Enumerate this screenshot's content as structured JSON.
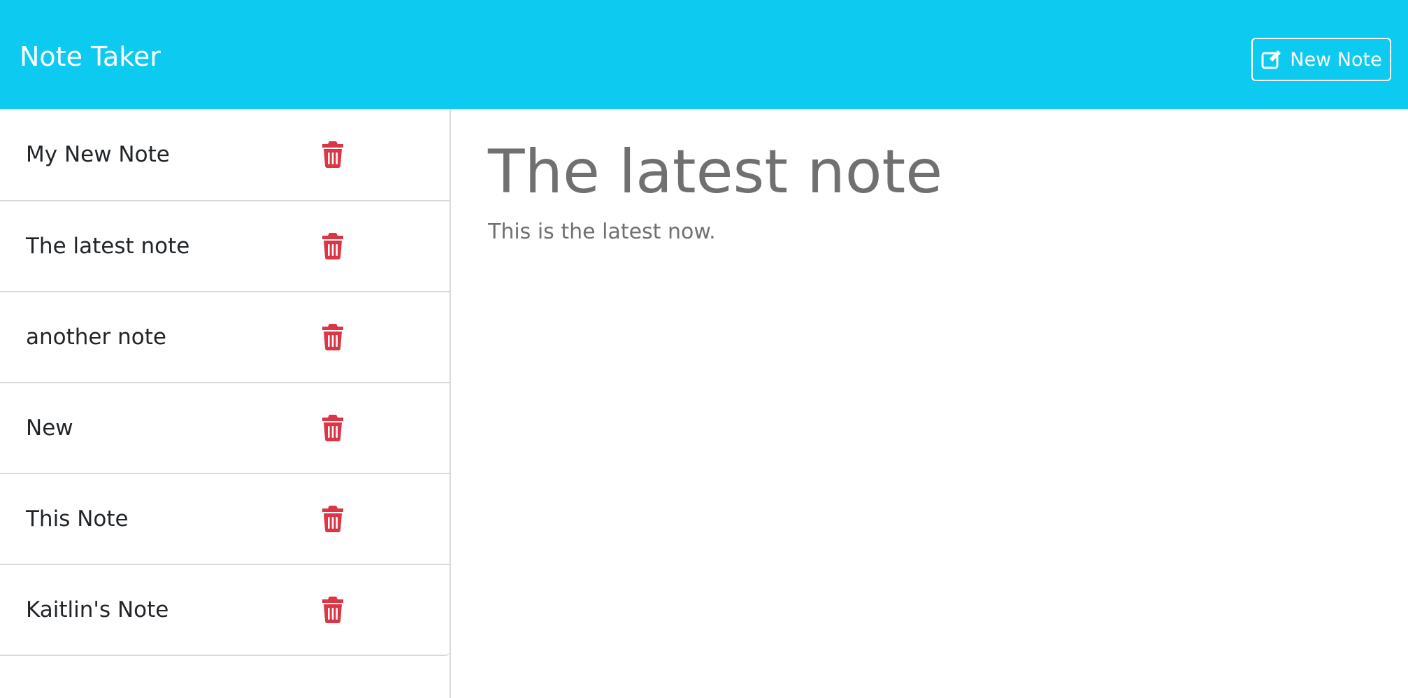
{
  "app": {
    "brand": "Note Taker",
    "accent_color": "#0dcaf0",
    "danger_color": "#dc3545"
  },
  "toolbar": {
    "new_note_label": "New Note",
    "new_note_icon": "edit-icon"
  },
  "sidebar": {
    "delete_icon": "trash-icon",
    "notes": [
      {
        "title": "My New Note"
      },
      {
        "title": "The latest note"
      },
      {
        "title": "another note"
      },
      {
        "title": "New"
      },
      {
        "title": "This Note"
      },
      {
        "title": "Kaitlin's Note"
      }
    ]
  },
  "main": {
    "title": "The latest note",
    "body": "This is the latest now."
  }
}
